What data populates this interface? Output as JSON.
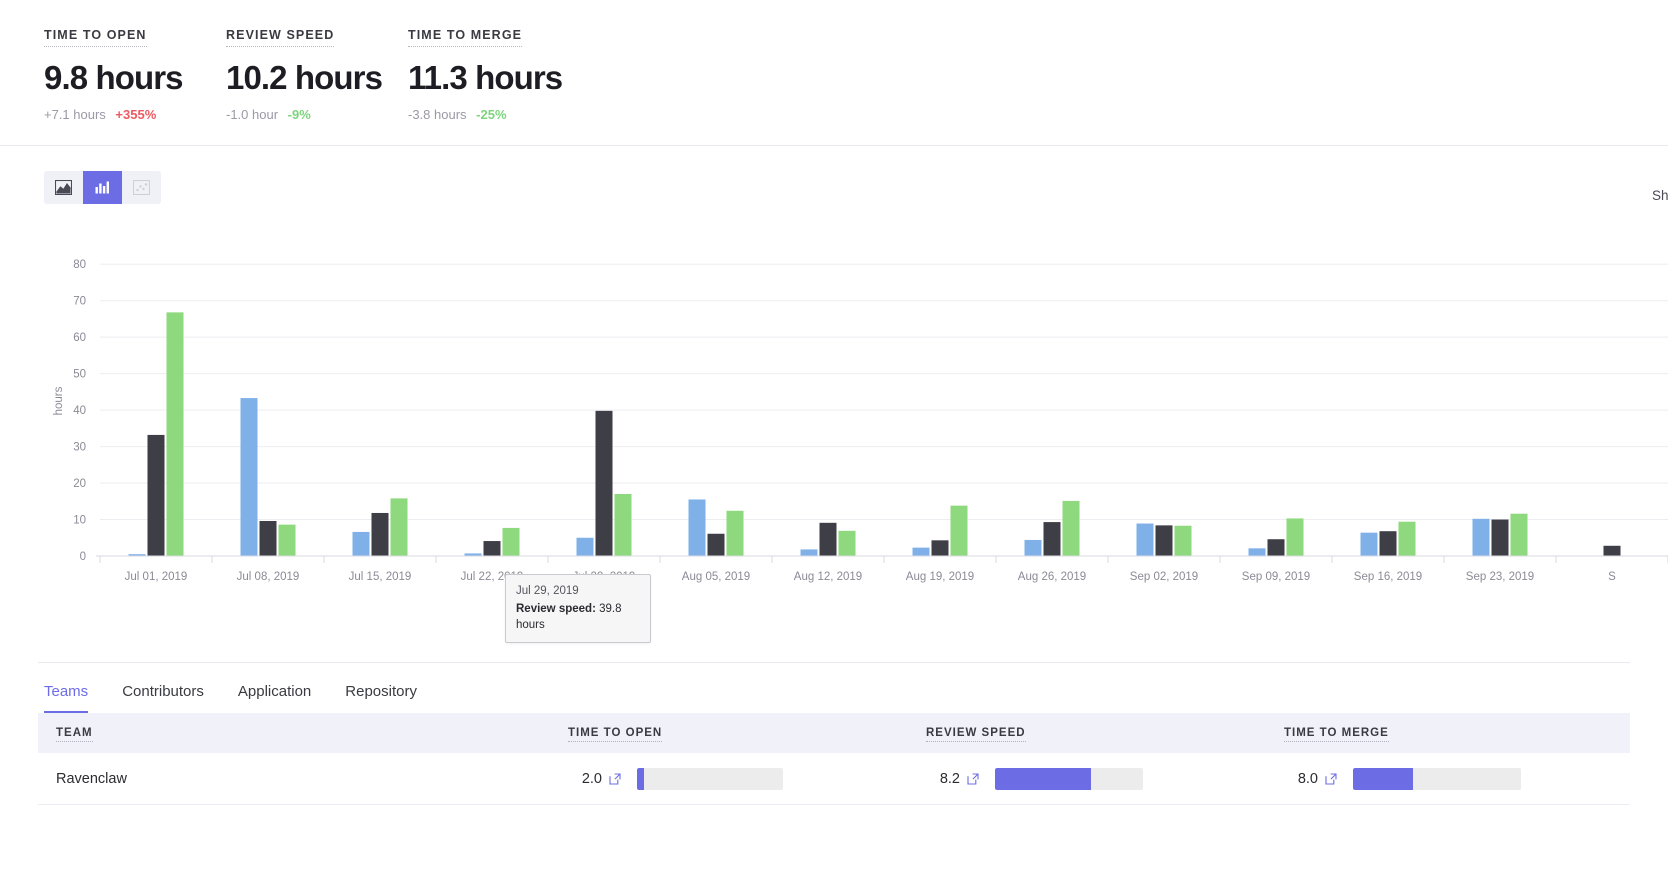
{
  "kpis": [
    {
      "label": "TIME TO OPEN",
      "value": "9.8 hours",
      "delta": "+7.1 hours",
      "pct": "+355%",
      "direction": "up"
    },
    {
      "label": "REVIEW SPEED",
      "value": "10.2 hours",
      "delta": "-1.0 hour",
      "pct": "-9%",
      "direction": "down"
    },
    {
      "label": "TIME TO MERGE",
      "value": "11.3 hours",
      "delta": "-3.8 hours",
      "pct": "-25%",
      "direction": "down"
    }
  ],
  "toolbar": {
    "buttons": [
      {
        "name": "area-chart-icon",
        "state": "inactive"
      },
      {
        "name": "bar-chart-icon",
        "state": "active"
      },
      {
        "name": "scatter-chart-icon",
        "state": "disabled"
      }
    ],
    "show_label": "Sho"
  },
  "tooltip": {
    "date": "Jul 29, 2019",
    "metric_label": "Review speed:",
    "metric_value": "39.8 hours"
  },
  "chart_data": {
    "type": "bar",
    "title": "",
    "xlabel": "",
    "ylabel": "hours",
    "ylim": [
      0,
      85
    ],
    "yticks": [
      0,
      10,
      20,
      30,
      40,
      50,
      60,
      70,
      80
    ],
    "grid": true,
    "legend_position": "none",
    "categories": [
      "Jul 01, 2019",
      "Jul 08, 2019",
      "Jul 15, 2019",
      "Jul 22, 2019",
      "Jul 29, 2019",
      "Aug 05, 2019",
      "Aug 12, 2019",
      "Aug 19, 2019",
      "Aug 26, 2019",
      "Sep 02, 2019",
      "Sep 09, 2019",
      "Sep 16, 2019",
      "Sep 23, 2019",
      "S"
    ],
    "series": [
      {
        "name": "Time to open",
        "color": "#7fb0e8",
        "values": [
          0.5,
          43.3,
          6.6,
          0.7,
          5.0,
          15.5,
          1.8,
          2.3,
          4.4,
          8.9,
          2.1,
          6.4,
          10.2,
          0.0
        ]
      },
      {
        "name": "Review speed",
        "color": "#3e3e46",
        "values": [
          33.2,
          9.6,
          11.8,
          4.1,
          39.8,
          6.1,
          9.1,
          4.3,
          9.3,
          8.4,
          4.6,
          6.8,
          10.0,
          2.8
        ]
      },
      {
        "name": "Time to merge",
        "color": "#8ed97e",
        "values": [
          66.8,
          8.6,
          15.8,
          7.7,
          17.0,
          12.4,
          6.9,
          13.8,
          15.1,
          8.3,
          10.3,
          9.4,
          11.6,
          0.0
        ]
      }
    ]
  },
  "tabs": [
    {
      "label": "Teams",
      "active": true
    },
    {
      "label": "Contributors",
      "active": false
    },
    {
      "label": "Application",
      "active": false
    },
    {
      "label": "Repository",
      "active": false
    }
  ],
  "table": {
    "headers": {
      "team": "TEAM",
      "time_to_open": "TIME TO OPEN",
      "review_speed": "REVIEW SPEED",
      "time_to_merge": "TIME TO MERGE"
    },
    "rows": [
      {
        "team": "Ravenclaw",
        "time_to_open": {
          "value": "2.0",
          "pct": 5
        },
        "review_speed": {
          "value": "8.2",
          "pct": 65
        },
        "time_to_merge": {
          "value": "8.0",
          "pct": 36
        }
      }
    ]
  },
  "colors": {
    "accent": "#6c6ce5",
    "bar_open": "#7fb0e8",
    "bar_review": "#3e3e46",
    "bar_merge": "#8ed97e",
    "up": "#ec5b62",
    "down": "#7ed47e"
  }
}
